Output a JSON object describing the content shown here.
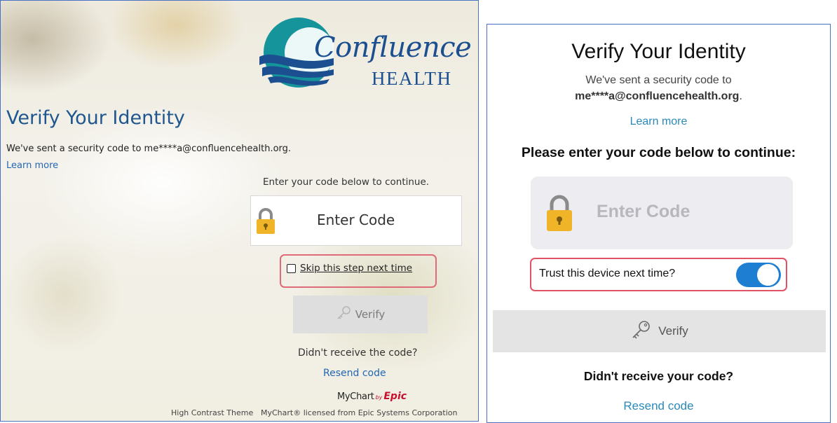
{
  "left": {
    "logo": {
      "word": "Confluence",
      "sub": "HEALTH"
    },
    "title": "Verify Your Identity",
    "sent_text": "We've sent a security code to me****a@confluencehealth.org.",
    "learn_more": "Learn more",
    "enter_prompt": "Enter your code below to continue.",
    "code_placeholder": "Enter Code",
    "skip_label": "Skip this step next time",
    "skip_checked": false,
    "verify_label": "Verify",
    "didnt_receive": "Didn't receive the code?",
    "resend": "Resend code",
    "mychart_brand": {
      "my": "MyChart",
      "by": "by",
      "epic": "Epic"
    },
    "footer": {
      "high_contrast": "High Contrast Theme",
      "license": "MyChart® licensed from Epic Systems Corporation"
    }
  },
  "right": {
    "title": "Verify Your Identity",
    "sent_line1": "We've sent a security code to",
    "sent_email": "me****a@confluencehealth.org",
    "sent_end": ".",
    "learn_more": "Learn more",
    "please_enter": "Please enter your code below to continue:",
    "code_placeholder": "Enter Code",
    "trust_label": "Trust this device next time?",
    "trust_on": true,
    "verify_label": "Verify",
    "didnt_receive": "Didn't receive your code?",
    "resend": "Resend code"
  },
  "icons": {
    "lock": "lock-icon",
    "key": "key-icon",
    "logo": "confluence-wave-logo"
  },
  "colors": {
    "accent_blue": "#21578f",
    "link_blue_desktop": "#2367b4",
    "link_blue_mobile": "#2a8ab8",
    "toggle_on": "#1d7ed2",
    "highlight_red": "#e06a78",
    "lock_gold": "#f0b429"
  }
}
